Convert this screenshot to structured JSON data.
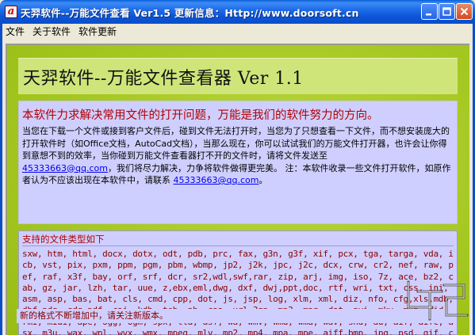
{
  "window": {
    "title": "天羿软件--万能文件查看  Ver1.5  更新信息：Http://www.doorsoft.cn",
    "app_icon_letter": "a",
    "controls": {
      "minimize": "–",
      "maximize": "□",
      "close": "✕"
    }
  },
  "menu": [
    "文件",
    "关于软件",
    "软件更新"
  ],
  "header": {
    "title": "天羿软件--万能文件查看器  Ver 1.1"
  },
  "info": {
    "headline": "本软件力求解决常用文件的打开问题，万能是我们的软件努力的方向。",
    "paragraph_1": "当您在下载一个文件或接到客户文件后，碰到文件无法打开时，当您为了只想查看一下文件，而不想安装庞大的打开软件时（如Office文档，AutoCad文档），当那么现在，你可以试试我们的万能文件打开器，也许会让你得到意想不到的效率，当你碰到万能文件查看器打不开的文件时，请将文件发送至",
    "email_1": "45333663@qq.com",
    "paragraph_2": "，我们将尽力解决，力争将软件做得更完美。    注：本软件收录一些文件打开软件，如原作者认为不应该出现在本软件中，请联系",
    "email_2": "45333663@qq.com",
    "paragraph_3": "。"
  },
  "types": {
    "heading": "支持的文件类型如下",
    "list": "sxw, htm, html, docx, dotx, odt, pdb, prc, fax, g3n, g3f, xif, pcx, tga, targa, vda, icb, vst, pix, pxm, ppm, pgm, pbm, wbmp, jp2, j2k, jpc, j2c, dcx, crw, cr2, nef, raw, pef, raf, x3f, bay, orf, srf, dcr, sr2,wdl,swf,rar, zip, arj, img, iso, 7z, ace, bz2, cab, gz, jar, lzh, tar, uue, z,ebx,eml,dwg, dxf, dwj,ppt,doc, rtf, wri, txt, css, ini, asm, asp, bas, bat, cls, cmd, cpp, dot, js, jsp, log, xlm, xml, diz, nfo, cfg,xls,mdb, dbf,pdg, qdg,pdf, caj, kdh, teb, nh, caa, url,3gp, mp3, mpg, dat, avi, mkv, mka, mid, rmi, midi, ape, ogg, ogm, spx, tta, asf, wa, wmv, wmd, wma, wav, snd, au, aif, aifc, asx, m3u, wax, wpl, wvx, wmx, mpeg, mlv, mp2, mp4, mpa, mpe, aiff,bmp, jpg, psd, gif, cur, tiff, png,ai, eps, cdr",
    "footer": "新的格式不断增加中，请关注新版本。"
  },
  "colors": {
    "titlebar": "#0b55d6",
    "background_green": "#a6c823",
    "header_panel": "#cfe57a",
    "info_panel": "#cfcfff",
    "headline_red": "#b20000",
    "list_text": "#8a0000"
  }
}
